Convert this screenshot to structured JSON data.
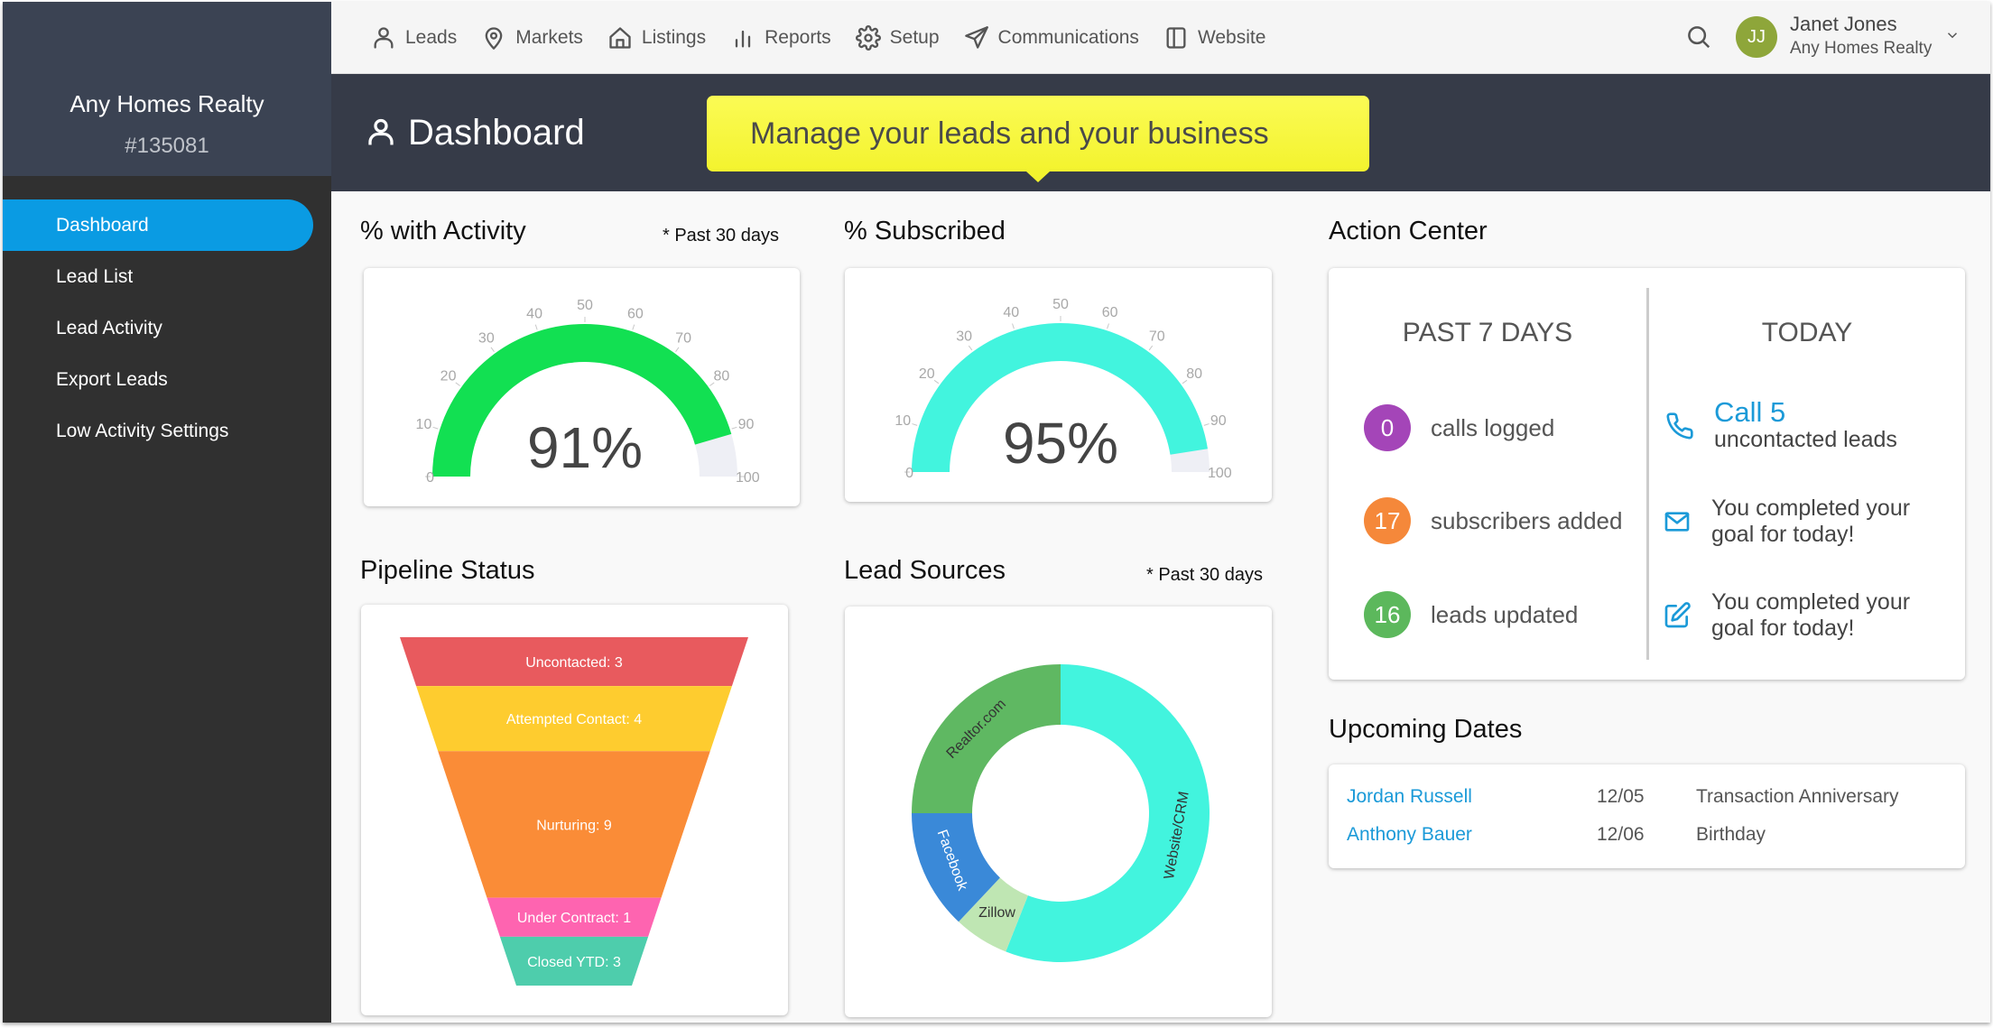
{
  "brand": {
    "name": "Any Homes Realty",
    "account_id": "#135081"
  },
  "sidebar": {
    "items": [
      {
        "label": "Dashboard",
        "active": true
      },
      {
        "label": "Lead List",
        "active": false
      },
      {
        "label": "Lead Activity",
        "active": false
      },
      {
        "label": "Export Leads",
        "active": false
      },
      {
        "label": "Low Activity Settings",
        "active": false
      }
    ]
  },
  "topnav": {
    "items": [
      {
        "label": "Leads",
        "icon": "user-icon"
      },
      {
        "label": "Markets",
        "icon": "map-pin-icon"
      },
      {
        "label": "Listings",
        "icon": "home-icon"
      },
      {
        "label": "Reports",
        "icon": "bar-chart-icon"
      },
      {
        "label": "Setup",
        "icon": "gear-icon"
      },
      {
        "label": "Communications",
        "icon": "send-icon"
      },
      {
        "label": "Website",
        "icon": "sidebar-layout-icon"
      }
    ],
    "search_icon": "search-icon"
  },
  "user": {
    "initials": "JJ",
    "name": "Janet Jones",
    "org": "Any Homes Realty",
    "avatar_color": "#8ea63a"
  },
  "header": {
    "title": "Dashboard",
    "tooltip": "Manage your leads and your business"
  },
  "activity": {
    "title": "% with Activity",
    "note": "* Past 30 days",
    "display": "91%"
  },
  "subscribed": {
    "title": "% Subscribed",
    "display": "95%"
  },
  "pipeline": {
    "title": "Pipeline Status"
  },
  "lead_sources": {
    "title": "Lead Sources",
    "note": "* Past 30 days"
  },
  "action_center": {
    "title": "Action Center",
    "past_head": "PAST 7 DAYS",
    "today_head": "TODAY",
    "past": [
      {
        "count": "0",
        "label": "calls logged",
        "color": "#a445b8"
      },
      {
        "count": "17",
        "label": "subscribers added",
        "color": "#f5883a"
      },
      {
        "count": "16",
        "label": "leads updated",
        "color": "#5cb85c"
      }
    ],
    "today": {
      "call_link": "Call 5",
      "call_sub": "uncontacted leads",
      "email_line1": "You completed your",
      "email_line2": "goal for today!",
      "edit_line1": "You completed your",
      "edit_line2": "goal for today!"
    }
  },
  "upcoming": {
    "title": "Upcoming Dates",
    "rows": [
      {
        "name": "Jordan Russell",
        "date": "12/05",
        "event": "Transaction Anniversary"
      },
      {
        "name": "Anthony Bauer",
        "date": "12/06",
        "event": "Birthday"
      }
    ]
  },
  "chart_data": [
    {
      "type": "gauge",
      "title": "% with Activity",
      "value": 91,
      "range": [
        0,
        100
      ],
      "ticks": [
        0,
        10,
        20,
        30,
        40,
        50,
        60,
        70,
        80,
        90,
        100
      ],
      "color": "#12e052",
      "track_color": "#eeeff5",
      "label": "91%"
    },
    {
      "type": "gauge",
      "title": "% Subscribed",
      "value": 95,
      "range": [
        0,
        100
      ],
      "ticks": [
        0,
        10,
        20,
        30,
        40,
        50,
        60,
        70,
        80,
        90,
        100
      ],
      "color": "#42f4de",
      "track_color": "#eeeff5",
      "label": "95%"
    },
    {
      "type": "funnel",
      "title": "Pipeline Status",
      "categories": [
        "Uncontacted",
        "Attempted Contact",
        "Nurturing",
        "Under Contract",
        "Closed YTD"
      ],
      "values": [
        3,
        4,
        9,
        1,
        3
      ],
      "labels": [
        "Uncontacted: 3",
        "Attempted Contact: 4",
        "Nurturing: 9",
        "Under Contract: 1",
        "Closed YTD: 3"
      ],
      "colors": [
        "#e85a5e",
        "#fecc2f",
        "#fa8c37",
        "#fe64b0",
        "#4ecdac"
      ]
    },
    {
      "type": "pie",
      "donut": true,
      "title": "Lead Sources",
      "categories": [
        "Website/CRM",
        "Zillow",
        "Facebook",
        "Realtor.com"
      ],
      "values": [
        56,
        6,
        13,
        25
      ],
      "colors": [
        "#42f4de",
        "#bfe6b3",
        "#3a89d8",
        "#5fb862"
      ],
      "label_colors": [
        "#333333",
        "#333333",
        "#ffffff",
        "#333333"
      ]
    }
  ]
}
